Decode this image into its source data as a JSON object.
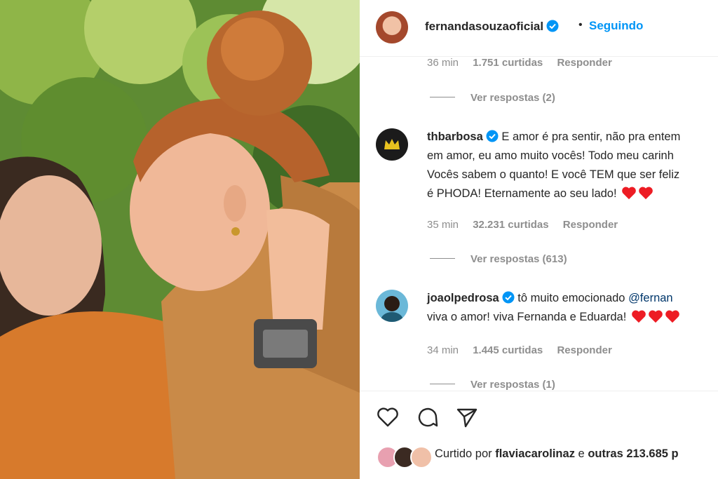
{
  "post": {
    "author": "fernandasouzaoficial",
    "follow_status": "Seguindo",
    "separator": "•"
  },
  "comments": [
    {
      "time": "36 min",
      "likes": "1.751 curtidas",
      "reply": "Responder",
      "view_replies": "Ver respostas (2)"
    },
    {
      "username": "thbarbosa",
      "lines": [
        "E amor é pra sentir, não pra entem",
        "em amor, eu amo muito vocês! Todo meu carinh",
        "Vocês sabem o quanto! E você TEM que ser feliz",
        "é PHODA! Eternamente ao seu lado!"
      ],
      "time": "35 min",
      "likes": "32.231 curtidas",
      "reply": "Responder",
      "view_replies": "Ver respostas (613)"
    },
    {
      "username": "joaolpedrosa",
      "text_start": "tô muito emocionado ",
      "mention": "@fernan",
      "line2": "viva o amor! viva Fernanda e Eduarda!",
      "time": "34 min",
      "likes": "1.445 curtidas",
      "reply": "Responder",
      "view_replies": "Ver respostas (1)"
    }
  ],
  "footer": {
    "liked_prefix": "Curtido por ",
    "liked_user": "flaviacarolinaz",
    "liked_middle": " e ",
    "liked_others": "outras 213.685 p"
  },
  "icons": [
    "heart-icon",
    "comment-icon",
    "share-icon",
    "verified-badge-icon"
  ],
  "colors": {
    "accent": "#0095f6",
    "verified": "#0095f6",
    "heart": "#ed1c24",
    "muted": "#8e8e8e"
  }
}
